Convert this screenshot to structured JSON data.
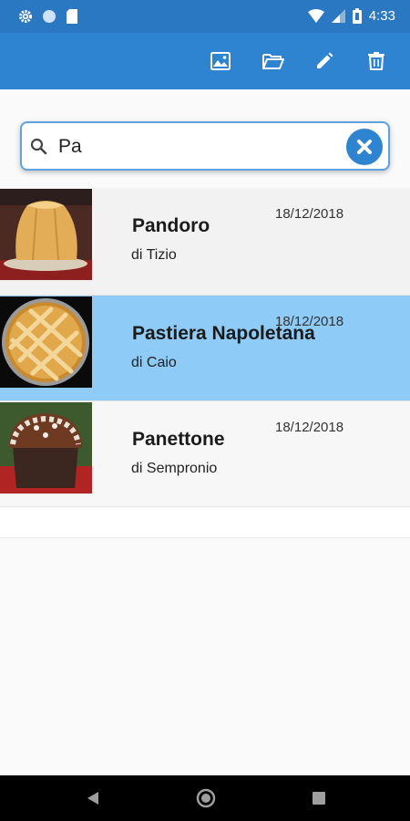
{
  "status_bar": {
    "time": "4:33",
    "icons": [
      "gear-icon",
      "circle-icon",
      "sd-card-icon",
      "wifi-icon",
      "signal-icon",
      "battery-icon"
    ]
  },
  "app_bar": {
    "actions": [
      "image-icon",
      "folder-open-icon",
      "pencil-icon",
      "trash-icon"
    ],
    "color": "#2f84d2"
  },
  "search": {
    "value": "Pa",
    "placeholder": ""
  },
  "recipes": [
    {
      "title": "Pandoro",
      "author": "di Tizio",
      "date": "18/12/2018",
      "selected": false
    },
    {
      "title": "Pastiera Napoletana",
      "author": "di Caio",
      "date": "18/12/2018",
      "selected": true
    },
    {
      "title": "Panettone",
      "author": "di Sempronio",
      "date": "18/12/2018",
      "selected": false
    }
  ],
  "colors": {
    "primary": "#2f84d2",
    "status_bar": "#2a78c2",
    "selected_row": "#8ecbf7"
  },
  "nav_bar": {
    "buttons": [
      "back-icon",
      "home-icon",
      "recents-icon"
    ]
  }
}
